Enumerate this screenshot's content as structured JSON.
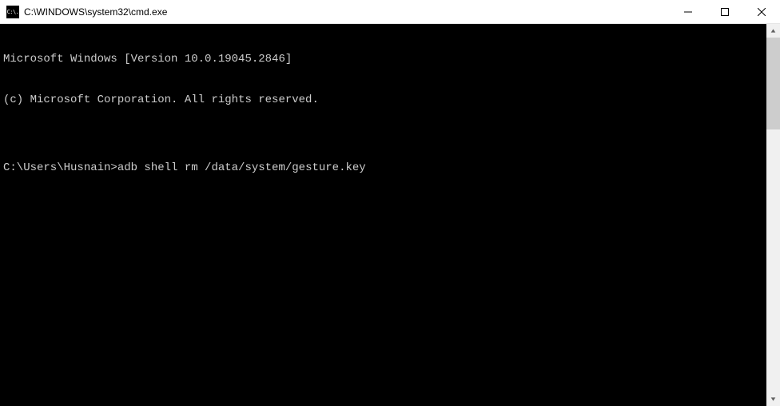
{
  "titlebar": {
    "icon_text": "C:\\.",
    "title": "C:\\WINDOWS\\system32\\cmd.exe"
  },
  "terminal": {
    "line1": "Microsoft Windows [Version 10.0.19045.2846]",
    "line2": "(c) Microsoft Corporation. All rights reserved.",
    "blank": "",
    "prompt": "C:\\Users\\Husnain>",
    "command": "adb shell rm /data/system/gesture.key"
  }
}
